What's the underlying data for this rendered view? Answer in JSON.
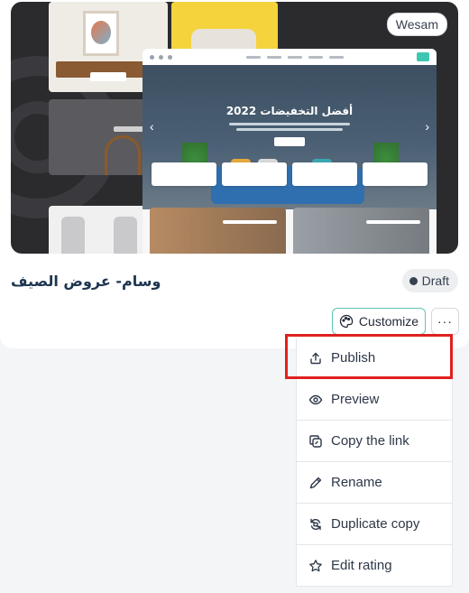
{
  "card": {
    "owner_badge": "Wesam",
    "preview": {
      "hero_title": "أفضل التخفيضات 2022"
    },
    "site_name": "وسام- عروض الصيف",
    "status": "Draft",
    "accent_color": "#5ec6b4"
  },
  "actions": {
    "customize_label": "Customize",
    "more_label": "···"
  },
  "menu": {
    "items": [
      {
        "label": "Publish",
        "icon": "publish-icon"
      },
      {
        "label": "Preview",
        "icon": "eye-icon"
      },
      {
        "label": "Copy the link",
        "icon": "copy-link-icon"
      },
      {
        "label": "Rename",
        "icon": "pencil-icon"
      },
      {
        "label": "Duplicate copy",
        "icon": "duplicate-icon"
      },
      {
        "label": "Edit rating",
        "icon": "star-icon"
      }
    ],
    "highlighted": "Publish",
    "highlight_color": "#e0201e"
  }
}
